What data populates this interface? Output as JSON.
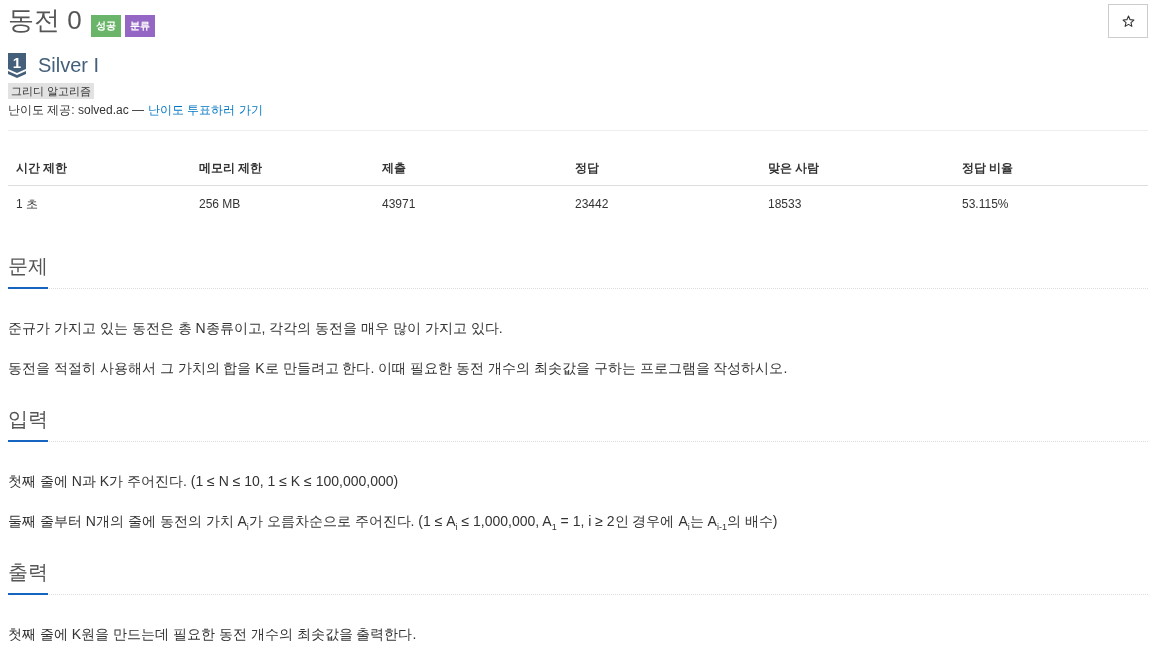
{
  "problem": {
    "title": "동전 0",
    "labels": [
      {
        "text": "성공",
        "color": "#6ab56a"
      },
      {
        "text": "분류",
        "color": "#9467c4"
      }
    ],
    "starred": false
  },
  "tier": {
    "badge": "1",
    "name": "Silver I"
  },
  "tags": [
    "그리디 알고리즘"
  ],
  "difficulty_source": {
    "text": "난이도 제공: solved.ac —",
    "link": "난이도 투표하러 가기"
  },
  "stats_table": {
    "columns": [
      "시간 제한",
      "메모리 제한",
      "제출",
      "정답",
      "맞은 사람",
      "정답 비율"
    ],
    "rows": [
      [
        "1 초",
        "256 MB",
        "43971",
        "23442",
        "18533",
        "53.115%"
      ]
    ]
  },
  "sections": [
    {
      "heading": "문제",
      "paragraphs": [
        "준규가 가지고 있는 동전은 총 N종류이고, 각각의 동전을 매우 많이 가지고 있다.",
        "동전을 적절히 사용해서 그 가치의 합을 K로 만들려고 한다. 이때 필요한 동전 개수의 최솟값을 구하는 프로그램을 작성하시오."
      ]
    },
    {
      "heading": "입력",
      "paragraphs": [
        "첫째 줄에 N과 K가 주어진다. (1 ≤ N ≤ 10, 1 ≤ K ≤ 100,000,000)",
        "둘째 줄부터 N개의 줄에 동전의 가치 A$_{i}$가 오름차순으로 주어진다. (1 ≤ A$_{i}$ ≤ 1,000,000, A$_{1}$ = 1, i ≥ 2인 경우에 A$_{i}$는 A$_{i-1}$의 배수)"
      ]
    },
    {
      "heading": "출력",
      "paragraphs": [
        "첫째 줄에 K원을 만드는데 필요한 동전 개수의 최솟값을 출력한다."
      ]
    }
  ]
}
